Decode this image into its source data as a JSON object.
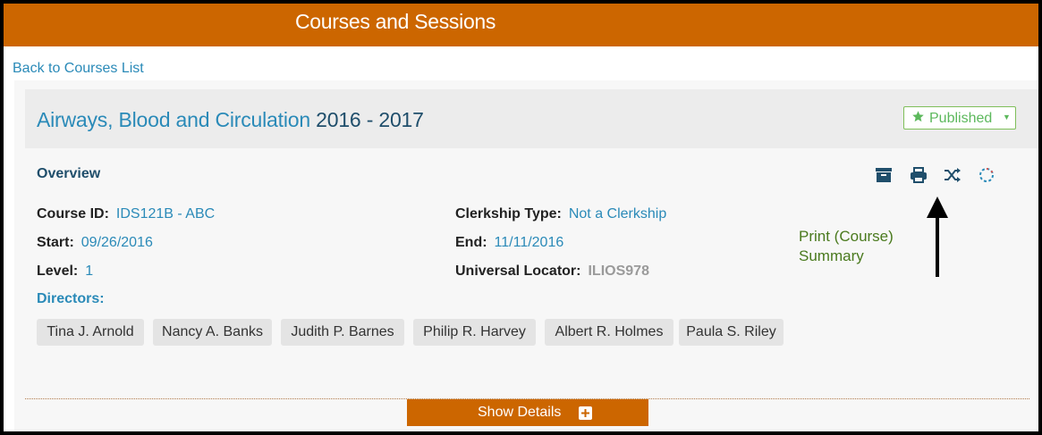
{
  "topbar": {
    "title": "Courses and Sessions"
  },
  "nav": {
    "back_link": "Back to Courses List"
  },
  "course": {
    "name": "Airways, Blood and Circulation",
    "year": "2016 - 2017",
    "status": {
      "label": "Published",
      "icon": "star-icon"
    }
  },
  "overview": {
    "title": "Overview",
    "toolbar_icons": [
      "archive-icon",
      "print-icon",
      "shuffle-icon",
      "loading-spinner-icon"
    ],
    "fields": {
      "course_id": {
        "label": "Course ID:",
        "value": "IDS121B - ABC"
      },
      "start": {
        "label": "Start:",
        "value": "09/26/2016"
      },
      "level": {
        "label": "Level:",
        "value": "1"
      },
      "clerkship_type": {
        "label": "Clerkship Type:",
        "value": "Not a Clerkship"
      },
      "end": {
        "label": "End:",
        "value": "11/11/2016"
      },
      "universal_locator": {
        "label": "Universal Locator:",
        "value": "ILIOS978"
      }
    },
    "directors_label": "Directors:",
    "directors": [
      "Tina J. Arnold",
      "Nancy A. Banks",
      "Judith P. Barnes",
      "Philip R. Harvey",
      "Albert R. Holmes",
      "Paula S. Riley"
    ]
  },
  "annotation": {
    "line1": "Print (Course)",
    "line2": "Summary"
  },
  "footer": {
    "show_details": "Show Details"
  },
  "colors": {
    "brand": "#cc6600",
    "link": "#2a8ab8",
    "heading": "#1f4e6b",
    "published": "#5cb85c",
    "annotation": "#4a7a1e"
  }
}
